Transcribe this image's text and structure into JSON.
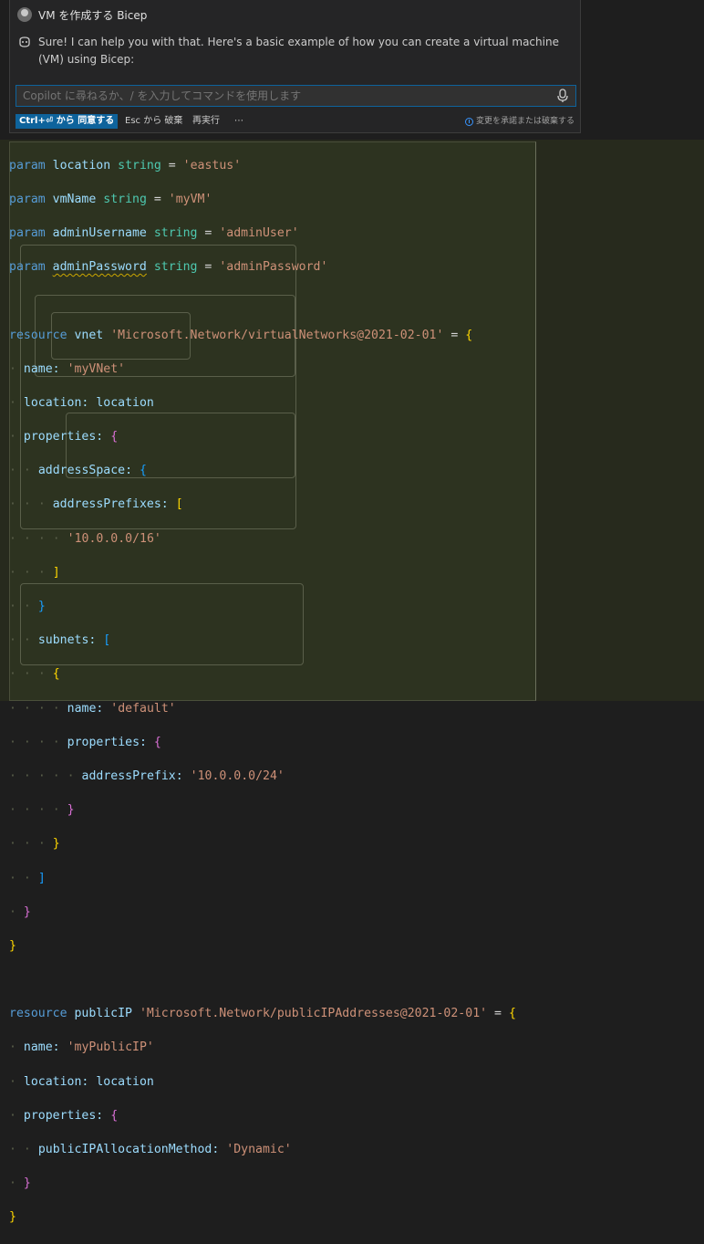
{
  "chat": {
    "user_message": "VM を作成する Bicep",
    "reply_text": "Sure! I can help you with that. Here's a basic example of how you can create a virtual machine (VM) using Bicep:",
    "input_placeholder": "Copilot に尋ねるか、/ を入力してコマンドを使用します",
    "accept_label": "Ctrl+⏎ から 同意する",
    "discard_label": "Esc から 破棄",
    "rerun_label": "再実行",
    "more_label": "⋯",
    "accept_note": "変更を承諾または破棄する"
  },
  "code": {
    "l1": [
      "param",
      "location",
      "string",
      "=",
      "'eastus'"
    ],
    "l2": [
      "param",
      "vmName",
      "string",
      "=",
      "'myVM'"
    ],
    "l3": [
      "param",
      "adminUsername",
      "string",
      "=",
      "'adminUser'"
    ],
    "l4": [
      "param",
      "adminPassword",
      "string",
      "=",
      "'adminPassword'"
    ],
    "vnet": [
      "resource",
      "vnet",
      "'Microsoft.Network/virtualNetworks@2021-02-01'",
      "=",
      "{"
    ],
    "vnet_name": [
      "name:",
      "'myVNet'"
    ],
    "vnet_location": [
      "location:",
      "location"
    ],
    "properties": "properties:",
    "addressSpace": "addressSpace:",
    "addressPrefixes": "addressPrefixes:",
    "prefix": "'10.0.0.0/16'",
    "subnets": "subnets:",
    "subnet_name": [
      "name:",
      "'default'"
    ],
    "addressPrefix": [
      "addressPrefix:",
      "'10.0.0.0/24'"
    ],
    "pip": [
      "resource",
      "publicIP",
      "'Microsoft.Network/publicIPAddresses@2021-02-01'",
      "=",
      "{"
    ],
    "pip_name": [
      "name:",
      "'myPublicIP'"
    ],
    "pip_location": [
      "location:",
      "location"
    ],
    "alloc": [
      "publicIPAllocationMethod:",
      "'Dynamic'"
    ]
  }
}
